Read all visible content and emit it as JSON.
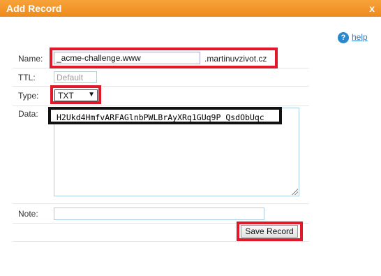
{
  "dialog": {
    "title": "Add Record",
    "close_label": "x",
    "help_label": "help"
  },
  "form": {
    "name_label": "Name:",
    "name_value": "_acme-challenge.www",
    "domain_suffix": ".martinuvzivot.cz",
    "ttl_label": "TTL:",
    "ttl_placeholder": "Default",
    "type_label": "Type:",
    "type_value": "TXT",
    "data_label": "Data:",
    "data_value": "H2Ukd4HmfvARFAGlnbPWLBrAyXRq1GUq9P_QsdObUqc",
    "note_label": "Note:",
    "note_value": "",
    "save_label": "Save Record"
  },
  "colors": {
    "titlebar": "#f39425",
    "highlight": "#e0182a",
    "link": "#2a7bd0"
  }
}
